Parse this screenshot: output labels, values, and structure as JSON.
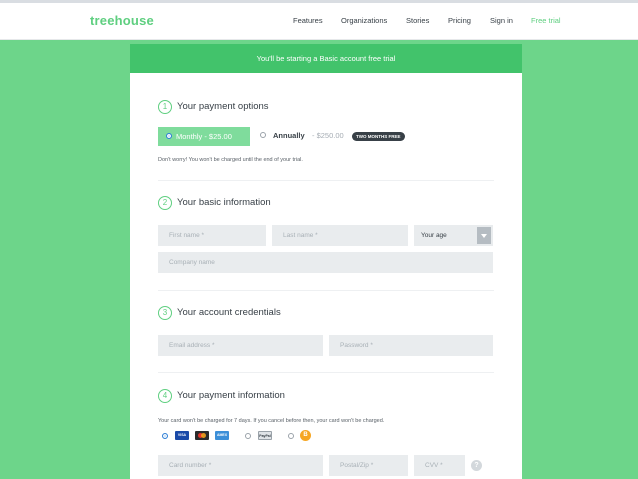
{
  "header": {
    "logo": "treehouse",
    "nav": [
      {
        "label": "Features",
        "name": "nav-features"
      },
      {
        "label": "Organizations",
        "name": "nav-organizations"
      },
      {
        "label": "Stories",
        "name": "nav-stories"
      },
      {
        "label": "Pricing",
        "name": "nav-pricing"
      },
      {
        "label": "Sign in",
        "name": "nav-sign-in"
      },
      {
        "label": "Free trial",
        "name": "nav-free-trial"
      }
    ]
  },
  "banner": "You'll be starting a Basic account free trial",
  "steps": [
    {
      "num": "1",
      "title": "Your payment options"
    },
    {
      "num": "2",
      "title": "Your basic information"
    },
    {
      "num": "3",
      "title": "Your account credentials"
    },
    {
      "num": "4",
      "title": "Your payment information"
    }
  ],
  "plans": {
    "monthly": "Monthly - $25.00",
    "annual_label": "Annually",
    "annual_price": "- $250.00",
    "badge": "TWO MONTHS FREE",
    "selected": "monthly"
  },
  "notes": {
    "charge": "Don't worry! You won't be charged until the end of your trial.",
    "card": "Your card won't be charged for 7 days. If you cancel before then, your card won't be charged."
  },
  "fields": {
    "first_name": "First name *",
    "last_name": "Last name *",
    "age": "Your age",
    "company": "Company name",
    "email": "Email address *",
    "password": "Password *",
    "card_number": "Card number *",
    "postal": "Postal/Zip *",
    "cvv": "CVV *"
  },
  "payment_methods": {
    "visa": "VISA",
    "amex": "AMEX",
    "paypal": "PayPal",
    "bitcoin": "B"
  },
  "help": "?",
  "colors": {
    "brand": "#5fcf80",
    "banner": "#42c36b",
    "background": "#6dd58a",
    "badge": "#384047"
  }
}
